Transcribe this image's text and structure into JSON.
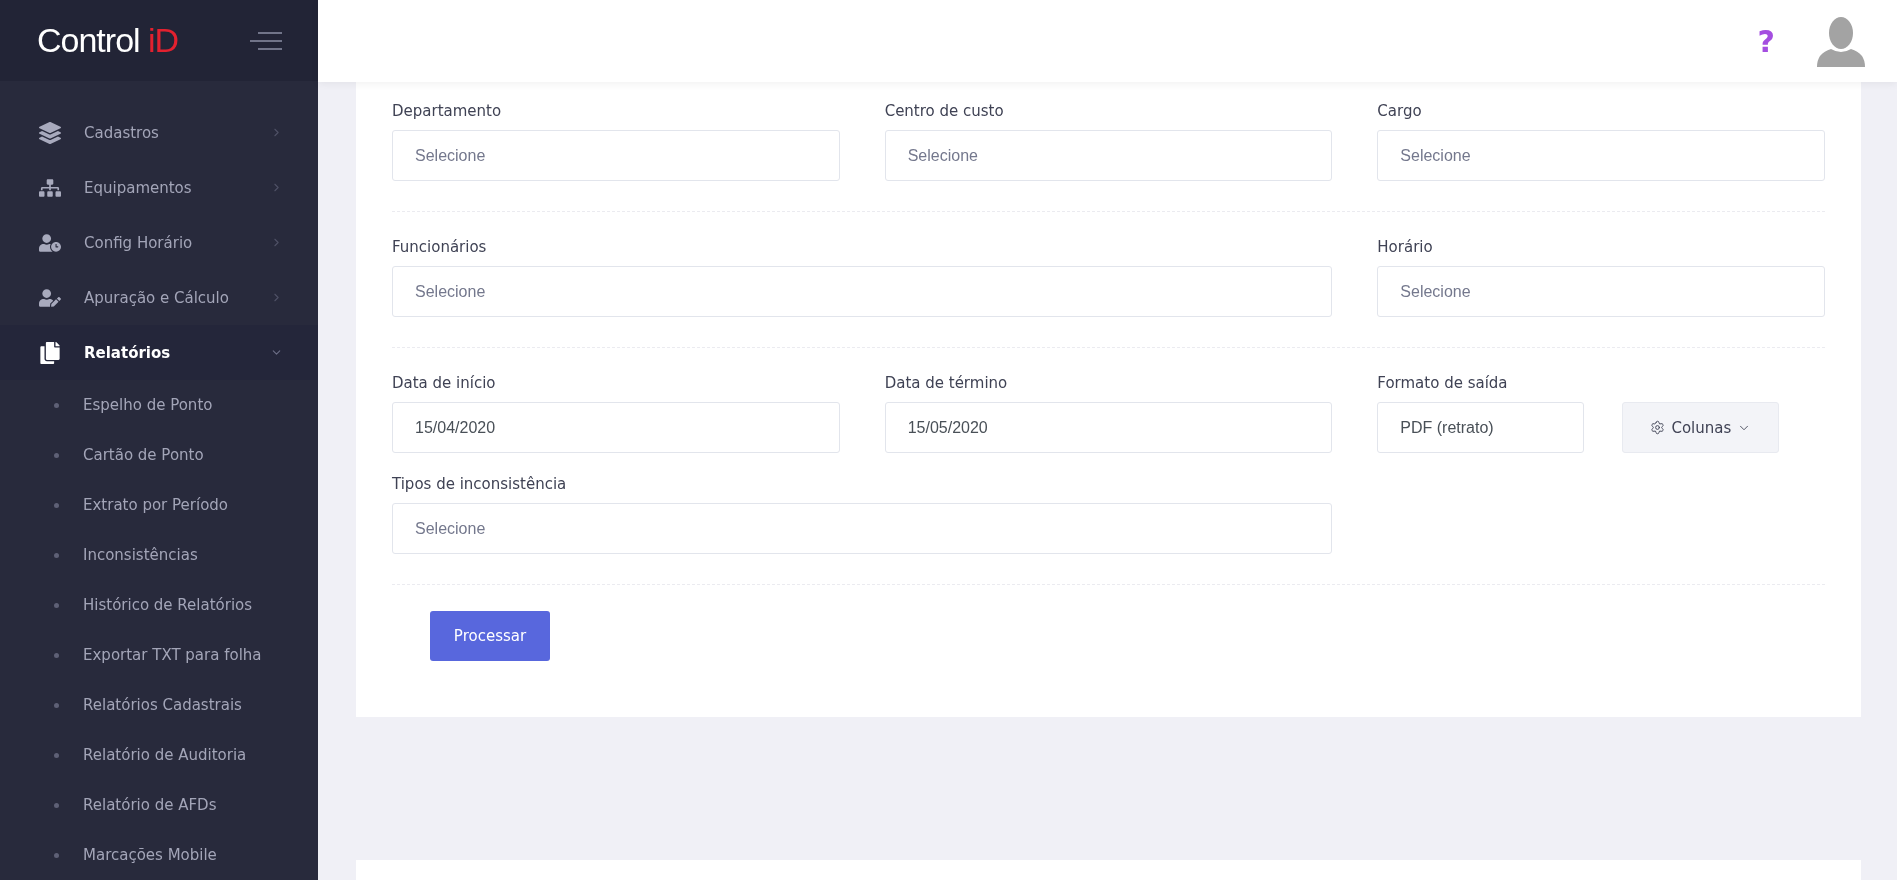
{
  "logo": {
    "text": "Control",
    "accent": "iD"
  },
  "sidebar": {
    "items": [
      {
        "label": "Cadastros",
        "expanded": false
      },
      {
        "label": "Equipamentos",
        "expanded": false
      },
      {
        "label": "Config Horário",
        "expanded": false
      },
      {
        "label": "Apuração e Cálculo",
        "expanded": false
      },
      {
        "label": "Relatórios",
        "expanded": true,
        "children": [
          {
            "label": "Espelho de Ponto"
          },
          {
            "label": "Cartão de Ponto"
          },
          {
            "label": "Extrato por Período"
          },
          {
            "label": "Inconsistências"
          },
          {
            "label": "Histórico de Relatórios"
          },
          {
            "label": "Exportar TXT para folha"
          },
          {
            "label": "Relatórios Cadastrais"
          },
          {
            "label": "Relatório de Auditoria"
          },
          {
            "label": "Relatório de AFDs"
          },
          {
            "label": "Marcações Mobile"
          }
        ]
      }
    ]
  },
  "header": {
    "help": "?"
  },
  "form": {
    "sections": [
      {
        "rows": [
          [
            {
              "label": "Departamento",
              "placeholder": "Selecione",
              "wide": false
            },
            {
              "label": "Centro de custo",
              "placeholder": "Selecione",
              "wide": false
            },
            {
              "label": "Cargo",
              "placeholder": "Selecione",
              "wide": false
            }
          ]
        ]
      },
      {
        "rows": [
          [
            {
              "label": "Funcionários",
              "placeholder": "Selecione",
              "wide": true
            },
            {
              "label": "Horário",
              "placeholder": "Selecione",
              "wide": false
            }
          ]
        ]
      },
      {
        "rows": [
          [
            {
              "label": "Data de início",
              "value": "15/04/2020",
              "wide": false
            },
            {
              "label": "Data de término",
              "value": "15/05/2020",
              "wide": false
            },
            {
              "label": "Formato de saída",
              "value": "PDF (retrato)",
              "wide": false,
              "button": {
                "label": "Colunas"
              }
            }
          ],
          [
            {
              "label": "Tipos de inconsistência",
              "placeholder": "Selecione",
              "wide": true
            }
          ]
        ]
      }
    ],
    "submit": "Processar"
  }
}
